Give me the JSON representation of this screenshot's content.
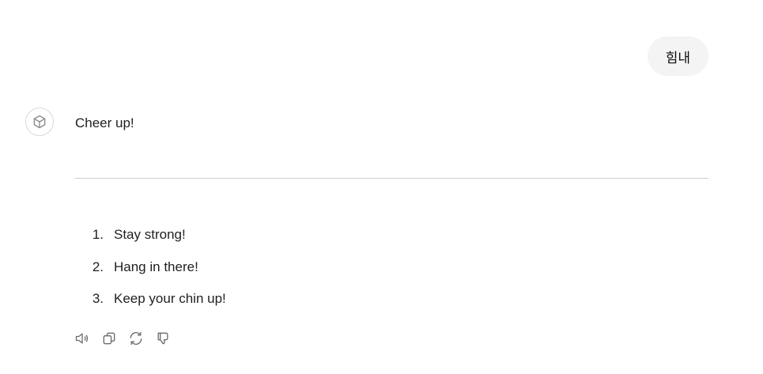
{
  "conversation": {
    "user_message": "힘내",
    "assistant": {
      "intro": "Cheer up!",
      "list": [
        {
          "number": "1.",
          "text": "Stay strong!"
        },
        {
          "number": "2.",
          "text": "Hang in there!"
        },
        {
          "number": "3.",
          "text": "Keep your chin up!"
        }
      ]
    }
  },
  "icons": {
    "avatar": "cube-icon",
    "actions": [
      "speaker-icon",
      "copy-icon",
      "regenerate-icon",
      "thumbs-down-icon"
    ]
  },
  "colors": {
    "user_bubble_bg": "#f4f4f4",
    "icon_gray": "#6b6b6b",
    "divider": "#cdcdcd"
  }
}
